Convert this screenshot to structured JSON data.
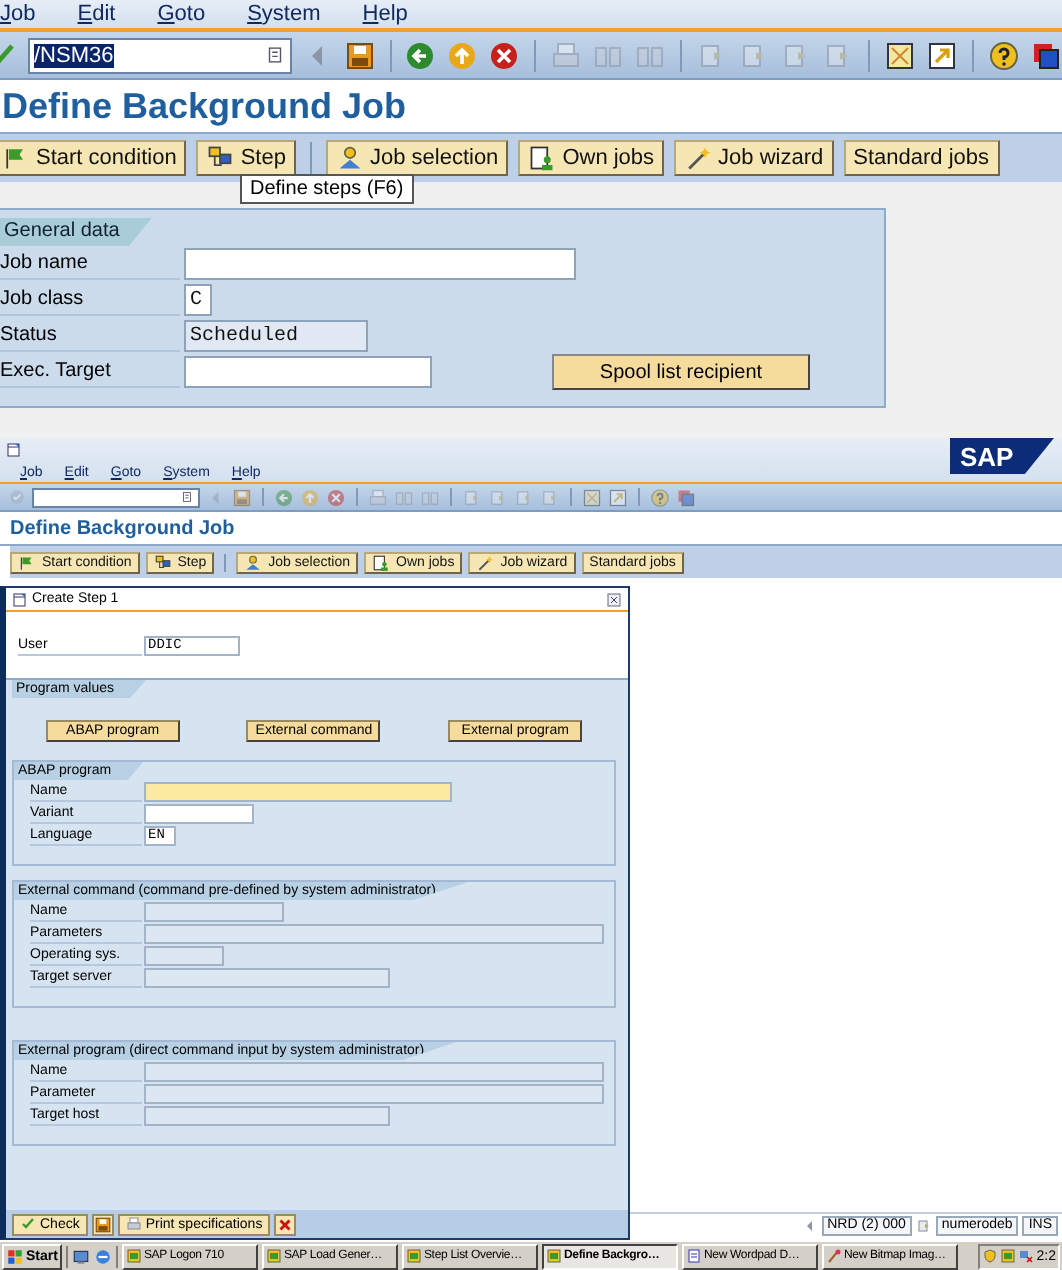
{
  "main_window": {
    "menu": [
      {
        "label": "Job"
      },
      {
        "label": "Edit"
      },
      {
        "label": "Goto"
      },
      {
        "label": "System"
      },
      {
        "label": "Help"
      }
    ],
    "command_field": {
      "value": "/NSM36",
      "text_selected": true
    },
    "title": "Define Background Job",
    "app_buttons": [
      {
        "label": "Start condition"
      },
      {
        "label": "Step"
      },
      {
        "label": "Job selection"
      },
      {
        "label": "Own jobs"
      },
      {
        "label": "Job wizard"
      },
      {
        "label": "Standard jobs"
      }
    ],
    "tooltip": "Define steps  (F6)",
    "general_data": {
      "title": "General data",
      "fields": [
        {
          "label": "Job name",
          "disabled": false
        },
        {
          "label": "Job class",
          "value": "C",
          "disabled": false
        },
        {
          "label": "Status",
          "value": "Scheduled",
          "disabled": true
        },
        {
          "label": "Exec. Target",
          "disabled": false
        }
      ],
      "button": "Spool list recipient"
    }
  },
  "background_window": {
    "menu": [
      {
        "label": "Job"
      },
      {
        "label": "Edit"
      },
      {
        "label": "Goto"
      },
      {
        "label": "System"
      },
      {
        "label": "Help"
      }
    ],
    "logo": "SAP",
    "title": "Define Background Job",
    "app_buttons": [
      {
        "label": "Start condition"
      },
      {
        "label": "Step"
      },
      {
        "label": "Job selection"
      },
      {
        "label": "Own jobs"
      },
      {
        "label": "Job wizard"
      },
      {
        "label": "Standard jobs"
      }
    ],
    "status_bar": {
      "system": "NRD (2) 000",
      "host": "numerodeb",
      "mode": "INS"
    }
  },
  "dialog": {
    "title": "Create Step  1",
    "user": {
      "label": "User",
      "value": "DDIC"
    },
    "program_values": {
      "title": "Program values",
      "buttons": [
        "ABAP program",
        "External command",
        "External program"
      ],
      "sections": [
        {
          "title": "ABAP program",
          "fields": [
            {
              "label": "Name",
              "focused": true,
              "disabled": false
            },
            {
              "label": "Variant",
              "focused": false,
              "disabled": false
            },
            {
              "label": "Language",
              "value": "EN",
              "focused": false,
              "disabled": false
            }
          ]
        },
        {
          "title": "External command (command pre-defined by system administrator)",
          "fields": [
            {
              "label": "Name",
              "focused": false,
              "disabled": true
            },
            {
              "label": "Parameters",
              "focused": false,
              "disabled": true
            },
            {
              "label": "Operating sys.",
              "focused": false,
              "disabled": true
            },
            {
              "label": "Target server",
              "focused": false,
              "disabled": true
            }
          ]
        },
        {
          "title": "External program (direct command input by system administrator)",
          "fields": [
            {
              "label": "Name",
              "focused": false,
              "disabled": true
            },
            {
              "label": "Parameter",
              "focused": false,
              "disabled": true
            },
            {
              "label": "Target host",
              "focused": false,
              "disabled": true
            }
          ]
        }
      ]
    },
    "footer_buttons": [
      {
        "label": "Check"
      },
      {
        "label": "Print specifications"
      }
    ]
  },
  "taskbar": {
    "start": "Start",
    "items": [
      {
        "label": "SAP Logon 710",
        "selected": false
      },
      {
        "label": "SAP Load Gener…",
        "selected": false
      },
      {
        "label": "Step List Overvie…",
        "selected": false
      },
      {
        "label": "Define Backgro…",
        "selected": true
      },
      {
        "label": "New Wordpad D…",
        "selected": false
      },
      {
        "label": "New Bitmap Imag…",
        "selected": false
      }
    ],
    "clock": "2:2"
  }
}
